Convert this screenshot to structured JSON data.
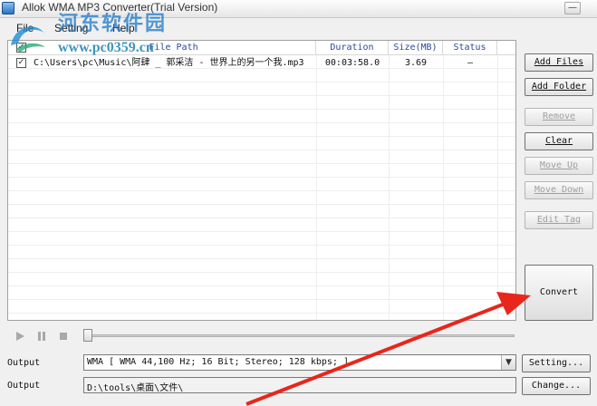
{
  "window": {
    "title": "Allok WMA MP3 Converter(Trial Version)",
    "minimize_glyph": "—"
  },
  "menu": {
    "items": [
      "File",
      "Setting",
      "Help"
    ]
  },
  "watermark": {
    "line1": "河东软件园",
    "line2": "www.pc0359.cn",
    "logo_icon": "swirl-logo-icon"
  },
  "filelist": {
    "columns": [
      "File Path",
      "Duration",
      "Size(MB)",
      "Status"
    ],
    "header_checked": true,
    "rows": [
      {
        "checked": true,
        "path": "C:\\Users\\pc\\Music\\阿肆 _ 郭采洁 - 世界上的另一个我.mp3",
        "duration": "00:03:58.0",
        "size": "3.69",
        "status": "—"
      }
    ]
  },
  "buttons": {
    "add_files": "Add Files",
    "add_folder": "Add Folder",
    "remove": "Remove",
    "clear": "Clear",
    "move_up": "Move Up",
    "move_down": "Move Down",
    "edit_tag": "Edit Tag",
    "convert": "Convert",
    "setting": "Setting...",
    "change": "Change..."
  },
  "player": {
    "play_icon": "play-icon",
    "pause_icon": "pause-icon",
    "stop_icon": "stop-icon",
    "position": 0
  },
  "output": {
    "format_label": "Output",
    "format_value": "WMA [ WMA 44,100 Hz; 16 Bit; Stereo; 128 kbps; ]",
    "path_label": "Output",
    "path_value": "D:\\tools\\桌面\\文件\\"
  },
  "colors": {
    "annotation_arrow": "#e8261c",
    "header_text": "#2b4a9a"
  }
}
